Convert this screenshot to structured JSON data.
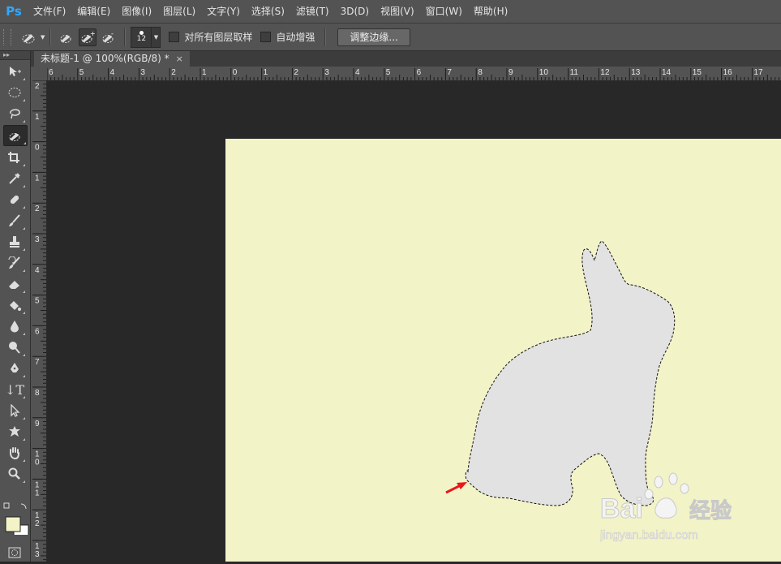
{
  "app": {
    "logo": "Ps"
  },
  "menu": [
    "文件(F)",
    "编辑(E)",
    "图像(I)",
    "图层(L)",
    "文字(Y)",
    "选择(S)",
    "滤镜(T)",
    "3D(D)",
    "视图(V)",
    "窗口(W)",
    "帮助(H)"
  ],
  "options": {
    "brush_size": "12",
    "sample_all_label": "对所有图层取样",
    "sample_all_checked": false,
    "auto_enhance_label": "自动增强",
    "auto_enhance_checked": false,
    "refine_edge_label": "调整边缘..."
  },
  "document_tab": {
    "title": "未标题-1 @ 100%(RGB/8) *",
    "close": "×"
  },
  "ruler": {
    "horizontal": [
      "6",
      "5",
      "4",
      "3",
      "2",
      "1",
      "0",
      "1",
      "2",
      "3",
      "4",
      "5",
      "6",
      "7",
      "8",
      "9",
      "10",
      "11",
      "12",
      "13",
      "14",
      "15",
      "16",
      "17"
    ],
    "vertical": [
      "2",
      "1",
      "0",
      "1",
      "2",
      "3",
      "4",
      "5",
      "6",
      "7",
      "8",
      "9",
      "1 0",
      "1 1",
      "1 2",
      "1 3"
    ]
  },
  "tools": [
    "move-tool",
    "marquee-tool",
    "lasso-tool",
    "quick-selection-tool",
    "crop-tool",
    "eyedropper-tool",
    "healing-brush-tool",
    "brush-tool",
    "clone-stamp-tool",
    "history-brush-tool",
    "eraser-tool",
    "paint-bucket-tool",
    "blur-tool",
    "dodge-tool",
    "pen-tool",
    "type-tool",
    "path-selection-tool",
    "shape-tool",
    "hand-tool",
    "zoom-tool"
  ],
  "active_tool": "quick-selection-tool",
  "colors": {
    "foreground": "#f3f3c8",
    "background": "#ffffff",
    "canvas": "#f3f3c8",
    "selection_fill": "#e2e2e2",
    "arrow": "#e8181b"
  },
  "watermark": {
    "brand": "Bai",
    "brand2": "经验",
    "url": "jingyan.baidu.com"
  }
}
